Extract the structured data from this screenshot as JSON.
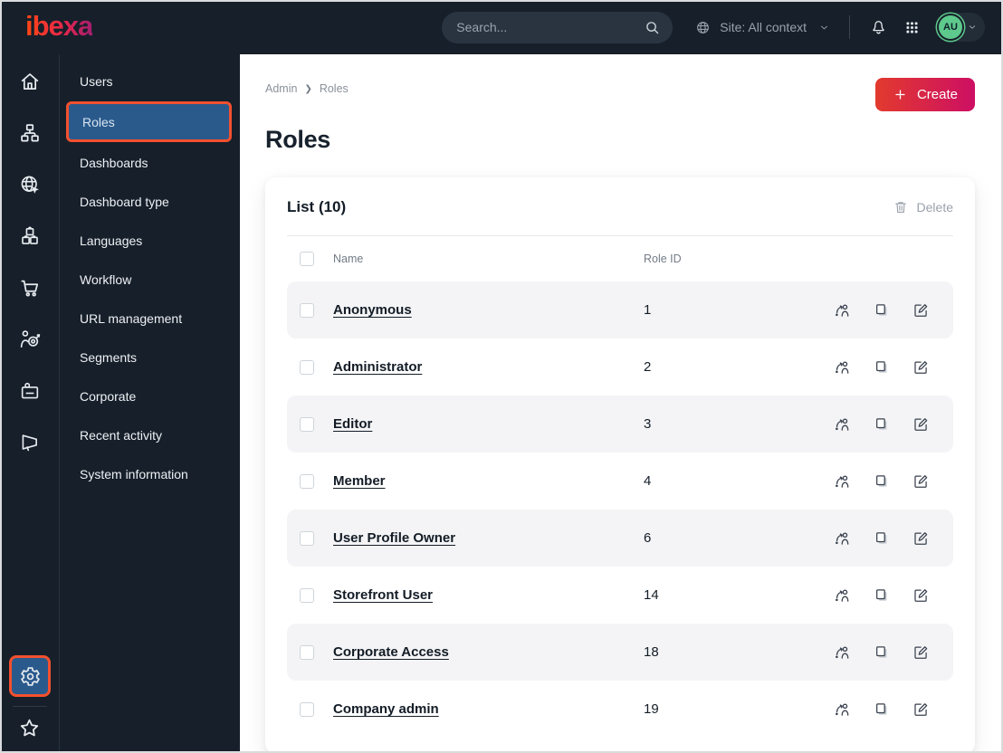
{
  "topbar": {
    "logo": "ibexa",
    "search_placeholder": "Search...",
    "site_context": "Site: All context",
    "avatar_initials": "AU",
    "icons": [
      "globe-icon",
      "chevron-down-icon",
      "bell-icon",
      "grid-icon"
    ]
  },
  "sidebar": {
    "rail_icons": [
      "home-icon",
      "content-tree-icon",
      "site-globe-icon",
      "products-icon",
      "commerce-cart-icon",
      "personalization-target-icon",
      "corporate-badge-icon",
      "marketing-megaphone-icon",
      "admin-gear-icon",
      "bookmarks-star-icon"
    ],
    "menu": [
      {
        "label": "Users",
        "selected": false
      },
      {
        "label": "Roles",
        "selected": true
      },
      {
        "label": "Dashboards",
        "selected": false
      },
      {
        "label": "Dashboard type",
        "selected": false
      },
      {
        "label": "Languages",
        "selected": false
      },
      {
        "label": "Workflow",
        "selected": false
      },
      {
        "label": "URL management",
        "selected": false
      },
      {
        "label": "Segments",
        "selected": false
      },
      {
        "label": "Corporate",
        "selected": false
      },
      {
        "label": "Recent activity",
        "selected": false
      },
      {
        "label": "System information",
        "selected": false
      }
    ]
  },
  "content": {
    "breadcrumb": [
      "Admin",
      "Roles"
    ],
    "create_label": "Create",
    "title": "Roles"
  },
  "panel": {
    "title": "List (10)",
    "delete_label": "Delete",
    "columns": {
      "name": "Name",
      "role_id": "Role ID"
    },
    "row_action_icons": [
      "assign-users-icon",
      "copy-icon",
      "edit-icon"
    ],
    "rows": [
      {
        "name": "Anonymous",
        "role_id": "1"
      },
      {
        "name": "Administrator",
        "role_id": "2"
      },
      {
        "name": "Editor",
        "role_id": "3"
      },
      {
        "name": "Member",
        "role_id": "4"
      },
      {
        "name": "User Profile Owner",
        "role_id": "6"
      },
      {
        "name": "Storefront User",
        "role_id": "14"
      },
      {
        "name": "Corporate Access",
        "role_id": "18"
      },
      {
        "name": "Company admin",
        "role_id": "19"
      }
    ]
  },
  "colors": {
    "topbar_bg": "#161f2a",
    "accent_orange": "#f4502e",
    "selected_blue": "#2a5a8c",
    "create_gradient_start": "#e23a2e",
    "create_gradient_end": "#cd0f63",
    "avatar_green": "#5ec98c",
    "logo_gradient": [
      "#ff4713",
      "#a21e6e"
    ],
    "zebra_row": "#f4f4f6"
  }
}
